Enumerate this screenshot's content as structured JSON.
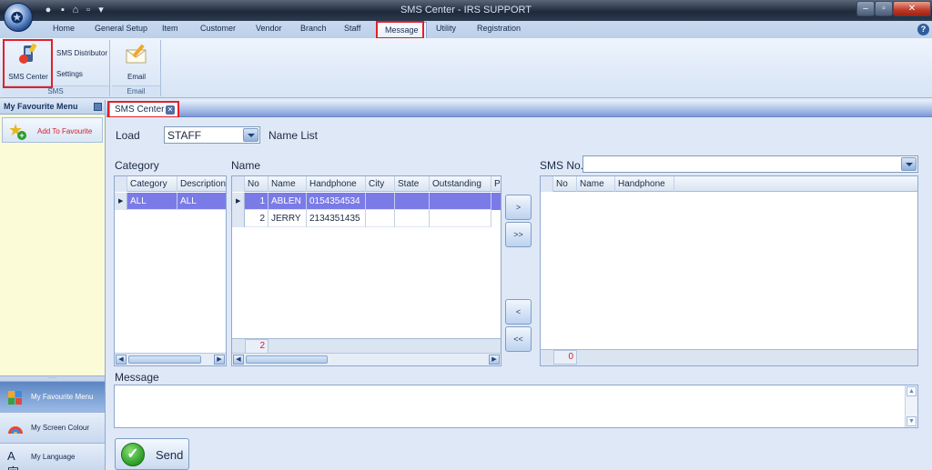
{
  "window": {
    "title": "SMS Center - IRS SUPPORT"
  },
  "ribbon": {
    "tabs": [
      "Home",
      "General Setup",
      "Item",
      "Customer",
      "Vendor",
      "Branch",
      "Staff",
      "Message",
      "Utility",
      "Registration"
    ],
    "active_tab": "Message",
    "groups": {
      "sms": {
        "label": "SMS",
        "sms_center": "SMS Center",
        "sms_distributor": "SMS Distributor",
        "settings": "Settings"
      },
      "email": {
        "label": "Email",
        "email": "Email"
      }
    }
  },
  "left_panel": {
    "title": "My Favourite Menu",
    "add_to_favourite": "Add To Favourite",
    "nav_items": [
      "My Favourite Menu",
      "My Screen Colour",
      "My Language"
    ]
  },
  "doc_tab": {
    "label": "SMS Center"
  },
  "form": {
    "load_label": "Load",
    "load_value": "STAFF",
    "name_list_label": "Name List",
    "category_label": "Category",
    "name_label": "Name",
    "sms_no_label": "SMS No.",
    "sms_no_value": "",
    "message_label": "Message",
    "message_value": "",
    "send_label": "Send"
  },
  "category_grid": {
    "columns": [
      "Category",
      "Description"
    ],
    "rows": [
      {
        "category": "ALL",
        "description": "ALL"
      }
    ]
  },
  "name_grid": {
    "columns": [
      "No",
      "Name",
      "Handphone",
      "City",
      "State",
      "Outstanding",
      "P"
    ],
    "rows": [
      {
        "no": "1",
        "name": "ABLEN",
        "handphone": "0154354534",
        "city": "",
        "state": "",
        "outstanding": ""
      },
      {
        "no": "2",
        "name": "JERRY",
        "handphone": "2134351435",
        "city": "",
        "state": "",
        "outstanding": ""
      }
    ],
    "count": "2"
  },
  "sms_grid": {
    "columns": [
      "No",
      "Name",
      "Handphone"
    ],
    "rows": [],
    "count": "0"
  },
  "move_buttons": {
    "add_one": ">",
    "add_all": ">>",
    "remove_one": "<",
    "remove_all": "<<"
  },
  "colors": {
    "highlight": "#e2202a",
    "selected_row": "#7b7be8",
    "title_bar": "#1f2a39"
  }
}
